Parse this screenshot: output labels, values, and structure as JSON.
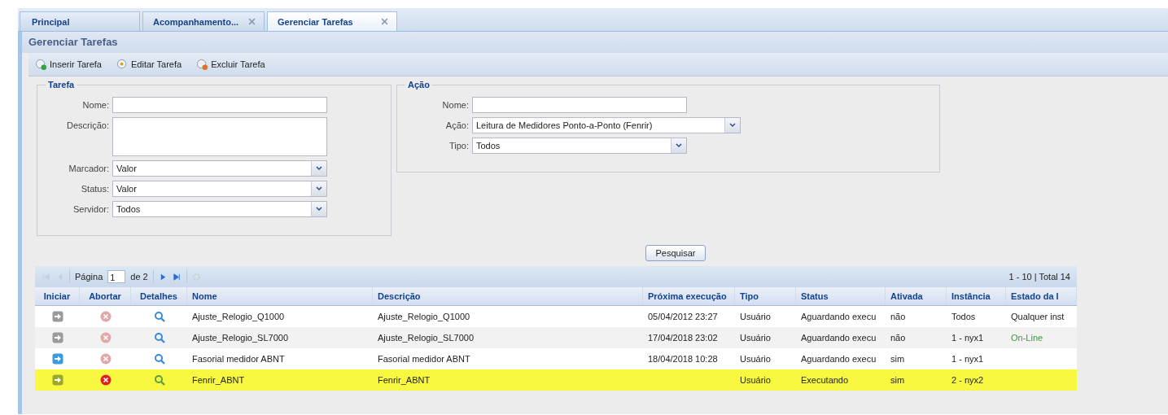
{
  "tabs": [
    {
      "label": "Principal",
      "selected": false,
      "closable": false
    },
    {
      "label": "Acompanhamento...",
      "selected": false,
      "closable": true
    },
    {
      "label": "Gerenciar Tarefas",
      "selected": true,
      "closable": true
    }
  ],
  "panel_title": "Gerenciar Tarefas",
  "toolbar": [
    {
      "label": "Inserir Tarefa",
      "kind": "add"
    },
    {
      "label": "Editar Tarefa",
      "kind": "edit"
    },
    {
      "label": "Excluir Tarefa",
      "kind": "delete"
    }
  ],
  "tarefa": {
    "legend": "Tarefa",
    "fields": [
      {
        "label": "Nome:",
        "kind": "text"
      },
      {
        "label": "Descrição:",
        "kind": "textarea"
      },
      {
        "label": "Marcador:",
        "kind": "combo",
        "value": "Valor"
      },
      {
        "label": "Status:",
        "kind": "combo",
        "value": "Valor"
      },
      {
        "label": "Servidor:",
        "kind": "combo",
        "value": "Todos"
      }
    ]
  },
  "acao": {
    "legend": "Ação",
    "fields": [
      {
        "label": "Nome:",
        "kind": "text"
      },
      {
        "label": "Ação:",
        "kind": "combo",
        "value": "Leitura de Medidores Ponto-a-Ponto (Fenrir)",
        "wide": true
      },
      {
        "label": "Tipo:",
        "kind": "combo",
        "value": "Todos",
        "wide": false
      }
    ]
  },
  "search_button": "Pesquisar",
  "pager": {
    "page_label": "Página",
    "page": "1",
    "of": "de 2",
    "summary": "1 - 10 | Total 14"
  },
  "table": {
    "columns": [
      "Iniciar",
      "Abortar",
      "Detalhes",
      "Nome",
      "Descrição",
      "Próxima execução",
      "Tipo",
      "Status",
      "Ativada",
      "Instância",
      "Estado da I"
    ],
    "rows": [
      {
        "start_enabled": false,
        "abort_enabled": false,
        "highlighted": false,
        "nome": "Ajuste_Relogio_Q1000",
        "descricao": "Ajuste_Relogio_Q1000",
        "proxima": "05/04/2012 23:27",
        "tipo": "Usuário",
        "status": "Aguardando execu",
        "ativada": "não",
        "instancia": "Todos",
        "estado": "Qualquer inst",
        "estado_online": false
      },
      {
        "start_enabled": false,
        "abort_enabled": false,
        "highlighted": false,
        "nome": "Ajuste_Relogio_SL7000",
        "descricao": "Ajuste_Relogio_SL7000",
        "proxima": "17/04/2018 23:02",
        "tipo": "Usuário",
        "status": "Aguardando execu",
        "ativada": "não",
        "instancia": "1 - nyx1",
        "estado": "On-Line",
        "estado_online": true
      },
      {
        "start_enabled": true,
        "abort_enabled": false,
        "highlighted": false,
        "nome": "Fasorial medidor ABNT",
        "descricao": "Fasorial medidor ABNT",
        "proxima": "18/04/2018 10:28",
        "tipo": "Usuário",
        "status": "Aguardando execu",
        "ativada": "sim",
        "instancia": "1 - nyx1"
      },
      {
        "start_enabled": true,
        "abort_enabled": true,
        "highlighted": true,
        "nome": "Fenrir_ABNT",
        "descricao": "Fenrir_ABNT",
        "tipo": "Usuário",
        "status": "Executando",
        "ativada": "sim",
        "instancia": "2 - nyx2"
      }
    ]
  }
}
